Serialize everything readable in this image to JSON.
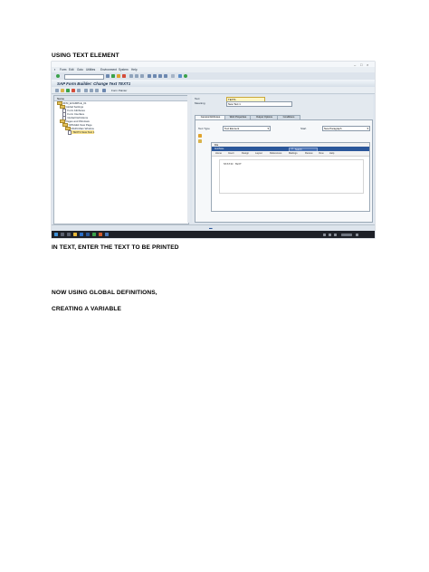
{
  "document": {
    "heading_1": "USING TEXT ELEMENT",
    "heading_2": "IN TEXT, ENTER THE TEXT TO BE PRINTED",
    "heading_3": "NOW USING GLOBAL DEFINITIONS,",
    "heading_4": "CREATING A VARIABLE"
  },
  "sap": {
    "menu": [
      "Form",
      "Edit",
      "Goto",
      "Utilities",
      "Environment",
      "System",
      "Help"
    ],
    "title": "SAP Form Builder: Change Text TEXT1",
    "app_toolbar_label": "Form Painter",
    "tree": {
      "header": "Name",
      "nodes": [
        {
          "label": "ZFM_EXAMPLE_01",
          "level": 0,
          "icon": "folder"
        },
        {
          "label": "Global Settings",
          "level": 1,
          "icon": "folder"
        },
        {
          "label": "Form Attributes",
          "level": 2,
          "icon": "doc"
        },
        {
          "label": "Form Interface",
          "level": 2,
          "icon": "doc"
        },
        {
          "label": "Global Definitions",
          "level": 2,
          "icon": "doc"
        },
        {
          "label": "Pages and Windows",
          "level": 1,
          "icon": "folder"
        },
        {
          "label": "%PAGE1 New Page",
          "level": 2,
          "icon": "folder"
        },
        {
          "label": "MAIN Main Window",
          "level": 3,
          "icon": "folder"
        },
        {
          "label": "TEXT1 New Text 1",
          "level": 4,
          "icon": "doc",
          "selected": true
        }
      ]
    },
    "fields": {
      "text_label": "Text",
      "text_value": "TEXT1",
      "meaning_label": "Meaning",
      "meaning_value": "New Text 1",
      "text_type_label": "Text Type",
      "text_type_value": "Text Element",
      "start_label": "Start",
      "start_value": "New Paragraph"
    },
    "tabs": [
      "General Attributes",
      "Web Properties",
      "Output Options",
      "Conditions"
    ],
    "editor": {
      "file_tab": "File",
      "quick_label": "AutoSave",
      "search_label": "Search",
      "ribbon": [
        "Home",
        "Insert",
        "Design",
        "Layout",
        "References",
        "Mailings",
        "Review",
        "View",
        "Help"
      ],
      "content": "STATIC TEXT"
    },
    "colors": {
      "sap_blue": "#2b579a",
      "selection": "#f8e08a",
      "taskbar": "#1e2128"
    }
  }
}
